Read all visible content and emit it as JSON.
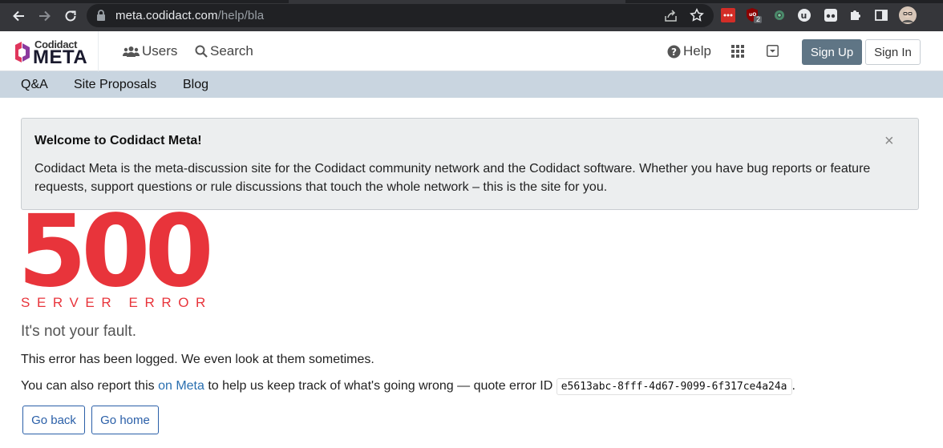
{
  "browser": {
    "url_host": "meta.codidact.com",
    "url_path": "/help/bla",
    "extensions": [
      "lastpass-icon",
      "ublock-icon",
      "gear-extension-icon",
      "u-extension-icon",
      "glasses-extension-icon",
      "puzzle-icon",
      "sidepanel-icon",
      "profile-avatar"
    ],
    "ublock_badge": "2"
  },
  "header": {
    "logo_top": "Codidact",
    "logo_main": "META",
    "users_label": "Users",
    "search_label": "Search",
    "help_label": "Help",
    "signup_label": "Sign Up",
    "signin_label": "Sign In"
  },
  "categories": [
    "Q&A",
    "Site Proposals",
    "Blog"
  ],
  "notice": {
    "title": "Welcome to Codidact Meta!",
    "body": "Codidact Meta is the meta-discussion site for the Codidact community network and the Codidact software. Whether you have bug reports or feature requests, support questions or rule discussions that touch the whole network – this is the site for you.",
    "close": "×"
  },
  "error": {
    "code": "500",
    "label": "SERVER ERROR",
    "fault": "It's not your fault.",
    "logged": "This error has been logged. We even look at them sometimes.",
    "report_pre": "You can also report this ",
    "report_link": "on Meta",
    "report_post": " to help us keep track of what's going wrong — quote error ID ",
    "error_id": "e5613abc-8fff-4d67-9099-6f317ce4a24a",
    "report_end": ".",
    "back_label": "Go back",
    "home_label": "Go home"
  },
  "colors": {
    "accent_red": "#e8343b",
    "catbar": "#c9d5e0",
    "signup_bg": "#5f7585",
    "link": "#2a6fb0"
  }
}
